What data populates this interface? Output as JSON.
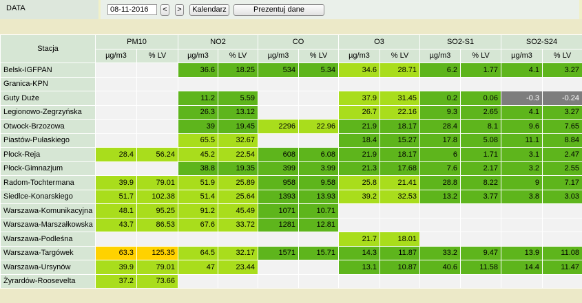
{
  "header": {
    "data_label": "DATA",
    "date_value": "08-11-2016",
    "prev_label": "<",
    "next_label": ">",
    "calendar_label": "Kalendarz",
    "present_label": "Prezentuj dane"
  },
  "table": {
    "station_header": "Stacja",
    "pollutants": [
      "PM10",
      "NO2",
      "CO",
      "O3",
      "SO2-S1",
      "SO2-S24"
    ],
    "units": [
      "µg/m3",
      "% LV"
    ],
    "colors": {
      "empty": "#f2f2f2",
      "dg": "#5eb51c",
      "lg": "#a9dd1c",
      "y": "#ffd200",
      "gr": "#7d7d7d"
    },
    "rows": [
      {
        "station": "Belsk-IGFPAN",
        "cells": [
          [
            "",
            ""
          ],
          [
            "36.6",
            "18.25",
            "dg"
          ],
          [
            "534",
            "5.34",
            "dg"
          ],
          [
            "34.6",
            "28.71",
            "lg"
          ],
          [
            "6.2",
            "1.77",
            "dg"
          ],
          [
            "4.1",
            "3.27",
            "dg"
          ]
        ]
      },
      {
        "station": "Granica-KPN",
        "cells": [
          [
            "",
            ""
          ],
          [
            "",
            ""
          ],
          [
            "",
            ""
          ],
          [
            "",
            ""
          ],
          [
            "",
            ""
          ],
          [
            "",
            ""
          ]
        ]
      },
      {
        "station": "Guty Duże",
        "cells": [
          [
            "",
            ""
          ],
          [
            "11.2",
            "5.59",
            "dg"
          ],
          [
            "",
            ""
          ],
          [
            "37.9",
            "31.45",
            "lg"
          ],
          [
            "0.2",
            "0.06",
            "dg"
          ],
          [
            "-0.3",
            "-0.24",
            "gr"
          ]
        ]
      },
      {
        "station": "Legionowo-Zegrzyńska",
        "cells": [
          [
            "",
            ""
          ],
          [
            "26.3",
            "13.12",
            "dg"
          ],
          [
            "",
            ""
          ],
          [
            "26.7",
            "22.16",
            "lg"
          ],
          [
            "9.3",
            "2.65",
            "dg"
          ],
          [
            "4.1",
            "3.27",
            "dg"
          ]
        ]
      },
      {
        "station": "Otwock-Brzozowa",
        "cells": [
          [
            "",
            ""
          ],
          [
            "39",
            "19.45",
            "dg"
          ],
          [
            "2296",
            "22.96",
            "lg"
          ],
          [
            "21.9",
            "18.17",
            "dg"
          ],
          [
            "28.4",
            "8.1",
            "dg"
          ],
          [
            "9.6",
            "7.65",
            "dg"
          ]
        ]
      },
      {
        "station": "Piastów-Pułaskiego",
        "cells": [
          [
            "",
            ""
          ],
          [
            "65.5",
            "32.67",
            "lg"
          ],
          [
            "",
            ""
          ],
          [
            "18.4",
            "15.27",
            "dg"
          ],
          [
            "17.8",
            "5.08",
            "dg"
          ],
          [
            "11.1",
            "8.84",
            "dg"
          ]
        ]
      },
      {
        "station": "Płock-Reja",
        "cells": [
          [
            "28.4",
            "56.24",
            "lg"
          ],
          [
            "45.2",
            "22.54",
            "lg"
          ],
          [
            "608",
            "6.08",
            "dg"
          ],
          [
            "21.9",
            "18.17",
            "dg"
          ],
          [
            "6",
            "1.71",
            "dg"
          ],
          [
            "3.1",
            "2.47",
            "dg"
          ]
        ]
      },
      {
        "station": "Płock-Gimnazjum",
        "cells": [
          [
            "",
            ""
          ],
          [
            "38.8",
            "19.35",
            "dg"
          ],
          [
            "399",
            "3.99",
            "dg"
          ],
          [
            "21.3",
            "17.68",
            "dg"
          ],
          [
            "7.6",
            "2.17",
            "dg"
          ],
          [
            "3.2",
            "2.55",
            "dg"
          ]
        ]
      },
      {
        "station": "Radom-Tochtermana",
        "cells": [
          [
            "39.9",
            "79.01",
            "lg"
          ],
          [
            "51.9",
            "25.89",
            "lg"
          ],
          [
            "958",
            "9.58",
            "dg"
          ],
          [
            "25.8",
            "21.41",
            "lg"
          ],
          [
            "28.8",
            "8.22",
            "dg"
          ],
          [
            "9",
            "7.17",
            "dg"
          ]
        ]
      },
      {
        "station": "Siedlce-Konarskiego",
        "cells": [
          [
            "51.7",
            "102.38",
            "lg"
          ],
          [
            "51.4",
            "25.64",
            "lg"
          ],
          [
            "1393",
            "13.93",
            "dg"
          ],
          [
            "39.2",
            "32.53",
            "lg"
          ],
          [
            "13.2",
            "3.77",
            "dg"
          ],
          [
            "3.8",
            "3.03",
            "dg"
          ]
        ]
      },
      {
        "station": "Warszawa-Komunikacyjna",
        "cells": [
          [
            "48.1",
            "95.25",
            "lg"
          ],
          [
            "91.2",
            "45.49",
            "lg"
          ],
          [
            "1071",
            "10.71",
            "dg"
          ],
          [
            "",
            ""
          ],
          [
            "",
            ""
          ],
          [
            "",
            ""
          ]
        ]
      },
      {
        "station": "Warszawa-Marszałkowska",
        "cells": [
          [
            "43.7",
            "86.53",
            "lg"
          ],
          [
            "67.6",
            "33.72",
            "lg"
          ],
          [
            "1281",
            "12.81",
            "dg"
          ],
          [
            "",
            ""
          ],
          [
            "",
            ""
          ],
          [
            "",
            ""
          ]
        ]
      },
      {
        "station": "Warszawa-Podleśna",
        "cells": [
          [
            "",
            ""
          ],
          [
            "",
            ""
          ],
          [
            "",
            ""
          ],
          [
            "21.7",
            "18.01",
            "lg"
          ],
          [
            "",
            ""
          ],
          [
            "",
            ""
          ]
        ]
      },
      {
        "station": "Warszawa-Targówek",
        "cells": [
          [
            "63.3",
            "125.35",
            "y"
          ],
          [
            "64.5",
            "32.17",
            "lg"
          ],
          [
            "1571",
            "15.71",
            "dg"
          ],
          [
            "14.3",
            "11.87",
            "dg"
          ],
          [
            "33.2",
            "9.47",
            "dg"
          ],
          [
            "13.9",
            "11.08",
            "dg"
          ]
        ]
      },
      {
        "station": "Warszawa-Ursynów",
        "cells": [
          [
            "39.9",
            "79.01",
            "lg"
          ],
          [
            "47",
            "23.44",
            "lg"
          ],
          [
            "",
            ""
          ],
          [
            "13.1",
            "10.87",
            "dg"
          ],
          [
            "40.6",
            "11.58",
            "dg"
          ],
          [
            "14.4",
            "11.47",
            "dg"
          ]
        ]
      },
      {
        "station": "Żyrardów-Roosevelta",
        "cells": [
          [
            "37.2",
            "73.66",
            "lg"
          ],
          [
            "",
            ""
          ],
          [
            "",
            ""
          ],
          [
            "",
            ""
          ],
          [
            "",
            ""
          ],
          [
            "",
            ""
          ]
        ]
      }
    ]
  }
}
